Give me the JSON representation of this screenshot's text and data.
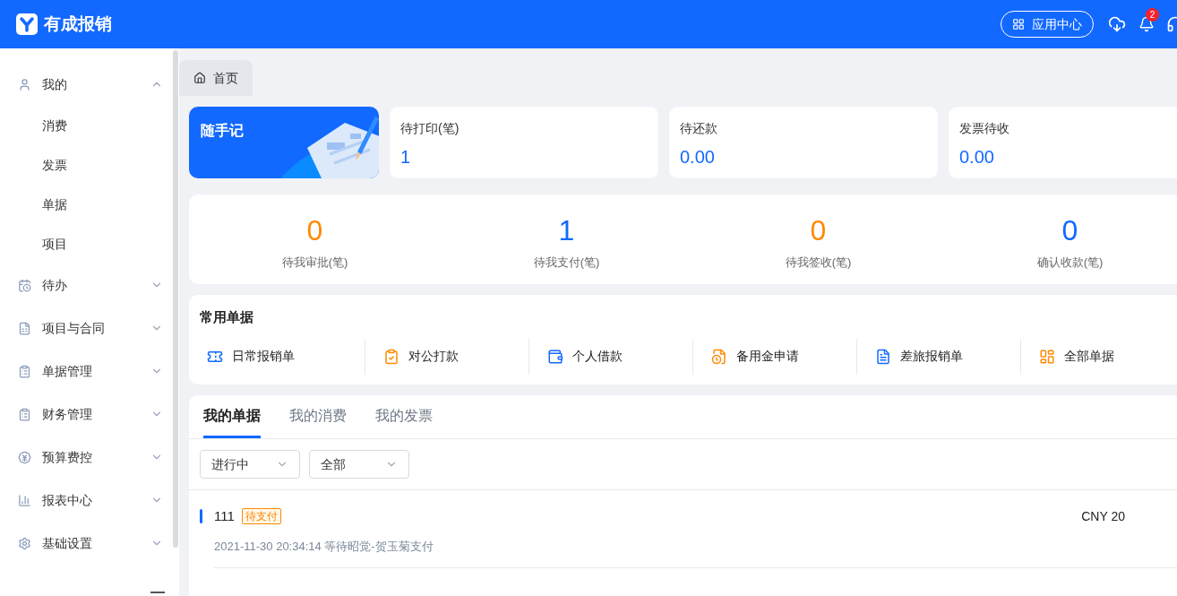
{
  "header": {
    "logo_text": "有成报销",
    "app_center_button": "应用中心",
    "notification_count": "2"
  },
  "sidebar": {
    "items": [
      {
        "label": "我的",
        "kind": "user",
        "expanded": true,
        "children": [
          {
            "label": "消费"
          },
          {
            "label": "发票"
          },
          {
            "label": "单据"
          },
          {
            "label": "项目"
          }
        ]
      },
      {
        "label": "待办",
        "kind": "todo",
        "expanded": false
      },
      {
        "label": "项目与合同",
        "kind": "contract",
        "expanded": false
      },
      {
        "label": "单据管理",
        "kind": "clipboard",
        "expanded": false
      },
      {
        "label": "财务管理",
        "kind": "clipboard",
        "expanded": false
      },
      {
        "label": "预算费控",
        "kind": "budget",
        "expanded": false
      },
      {
        "label": "报表中心",
        "kind": "chart",
        "expanded": false
      },
      {
        "label": "基础设置",
        "kind": "settings",
        "expanded": false
      }
    ]
  },
  "tabs": [
    {
      "label": "首页",
      "selected": true
    }
  ],
  "quick_note": {
    "title": "随手记"
  },
  "summary_cards": [
    {
      "label": "待打印(笔)",
      "value": "1"
    },
    {
      "label": "待还款",
      "value": "0.00"
    },
    {
      "label": "发票待收",
      "value": "0.00"
    }
  ],
  "stats": [
    {
      "value": "0",
      "label": "待我审批(笔)",
      "color": "#ff8a00"
    },
    {
      "value": "1",
      "label": "待我支付(笔)",
      "color": "#1269ff"
    },
    {
      "value": "0",
      "label": "待我签收(笔)",
      "color": "#ff8a00"
    },
    {
      "value": "0",
      "label": "确认收款(笔)",
      "color": "#1269ff"
    }
  ],
  "common_docs": {
    "title": "常用单据",
    "items": [
      {
        "label": "日常报销单",
        "kind": "ticket"
      },
      {
        "label": "对公打款",
        "kind": "clipboard"
      },
      {
        "label": "个人借款",
        "kind": "wallet"
      },
      {
        "label": "备用金申请",
        "kind": "reserve"
      },
      {
        "label": "差旅报销单",
        "kind": "document"
      },
      {
        "label": "全部单据",
        "kind": "grid"
      }
    ]
  },
  "my_docs": {
    "tabs": [
      {
        "label": "我的单据",
        "selected": true
      },
      {
        "label": "我的消费",
        "selected": false
      },
      {
        "label": "我的发票",
        "selected": false
      }
    ],
    "filters": [
      {
        "value": "进行中"
      },
      {
        "value": "全部"
      }
    ],
    "records": [
      {
        "number": "111",
        "status": "待支付",
        "info": "2021-11-30 20:34:14 等待昭觉-贺玉菊支付",
        "amount": "CNY 20"
      }
    ]
  }
}
